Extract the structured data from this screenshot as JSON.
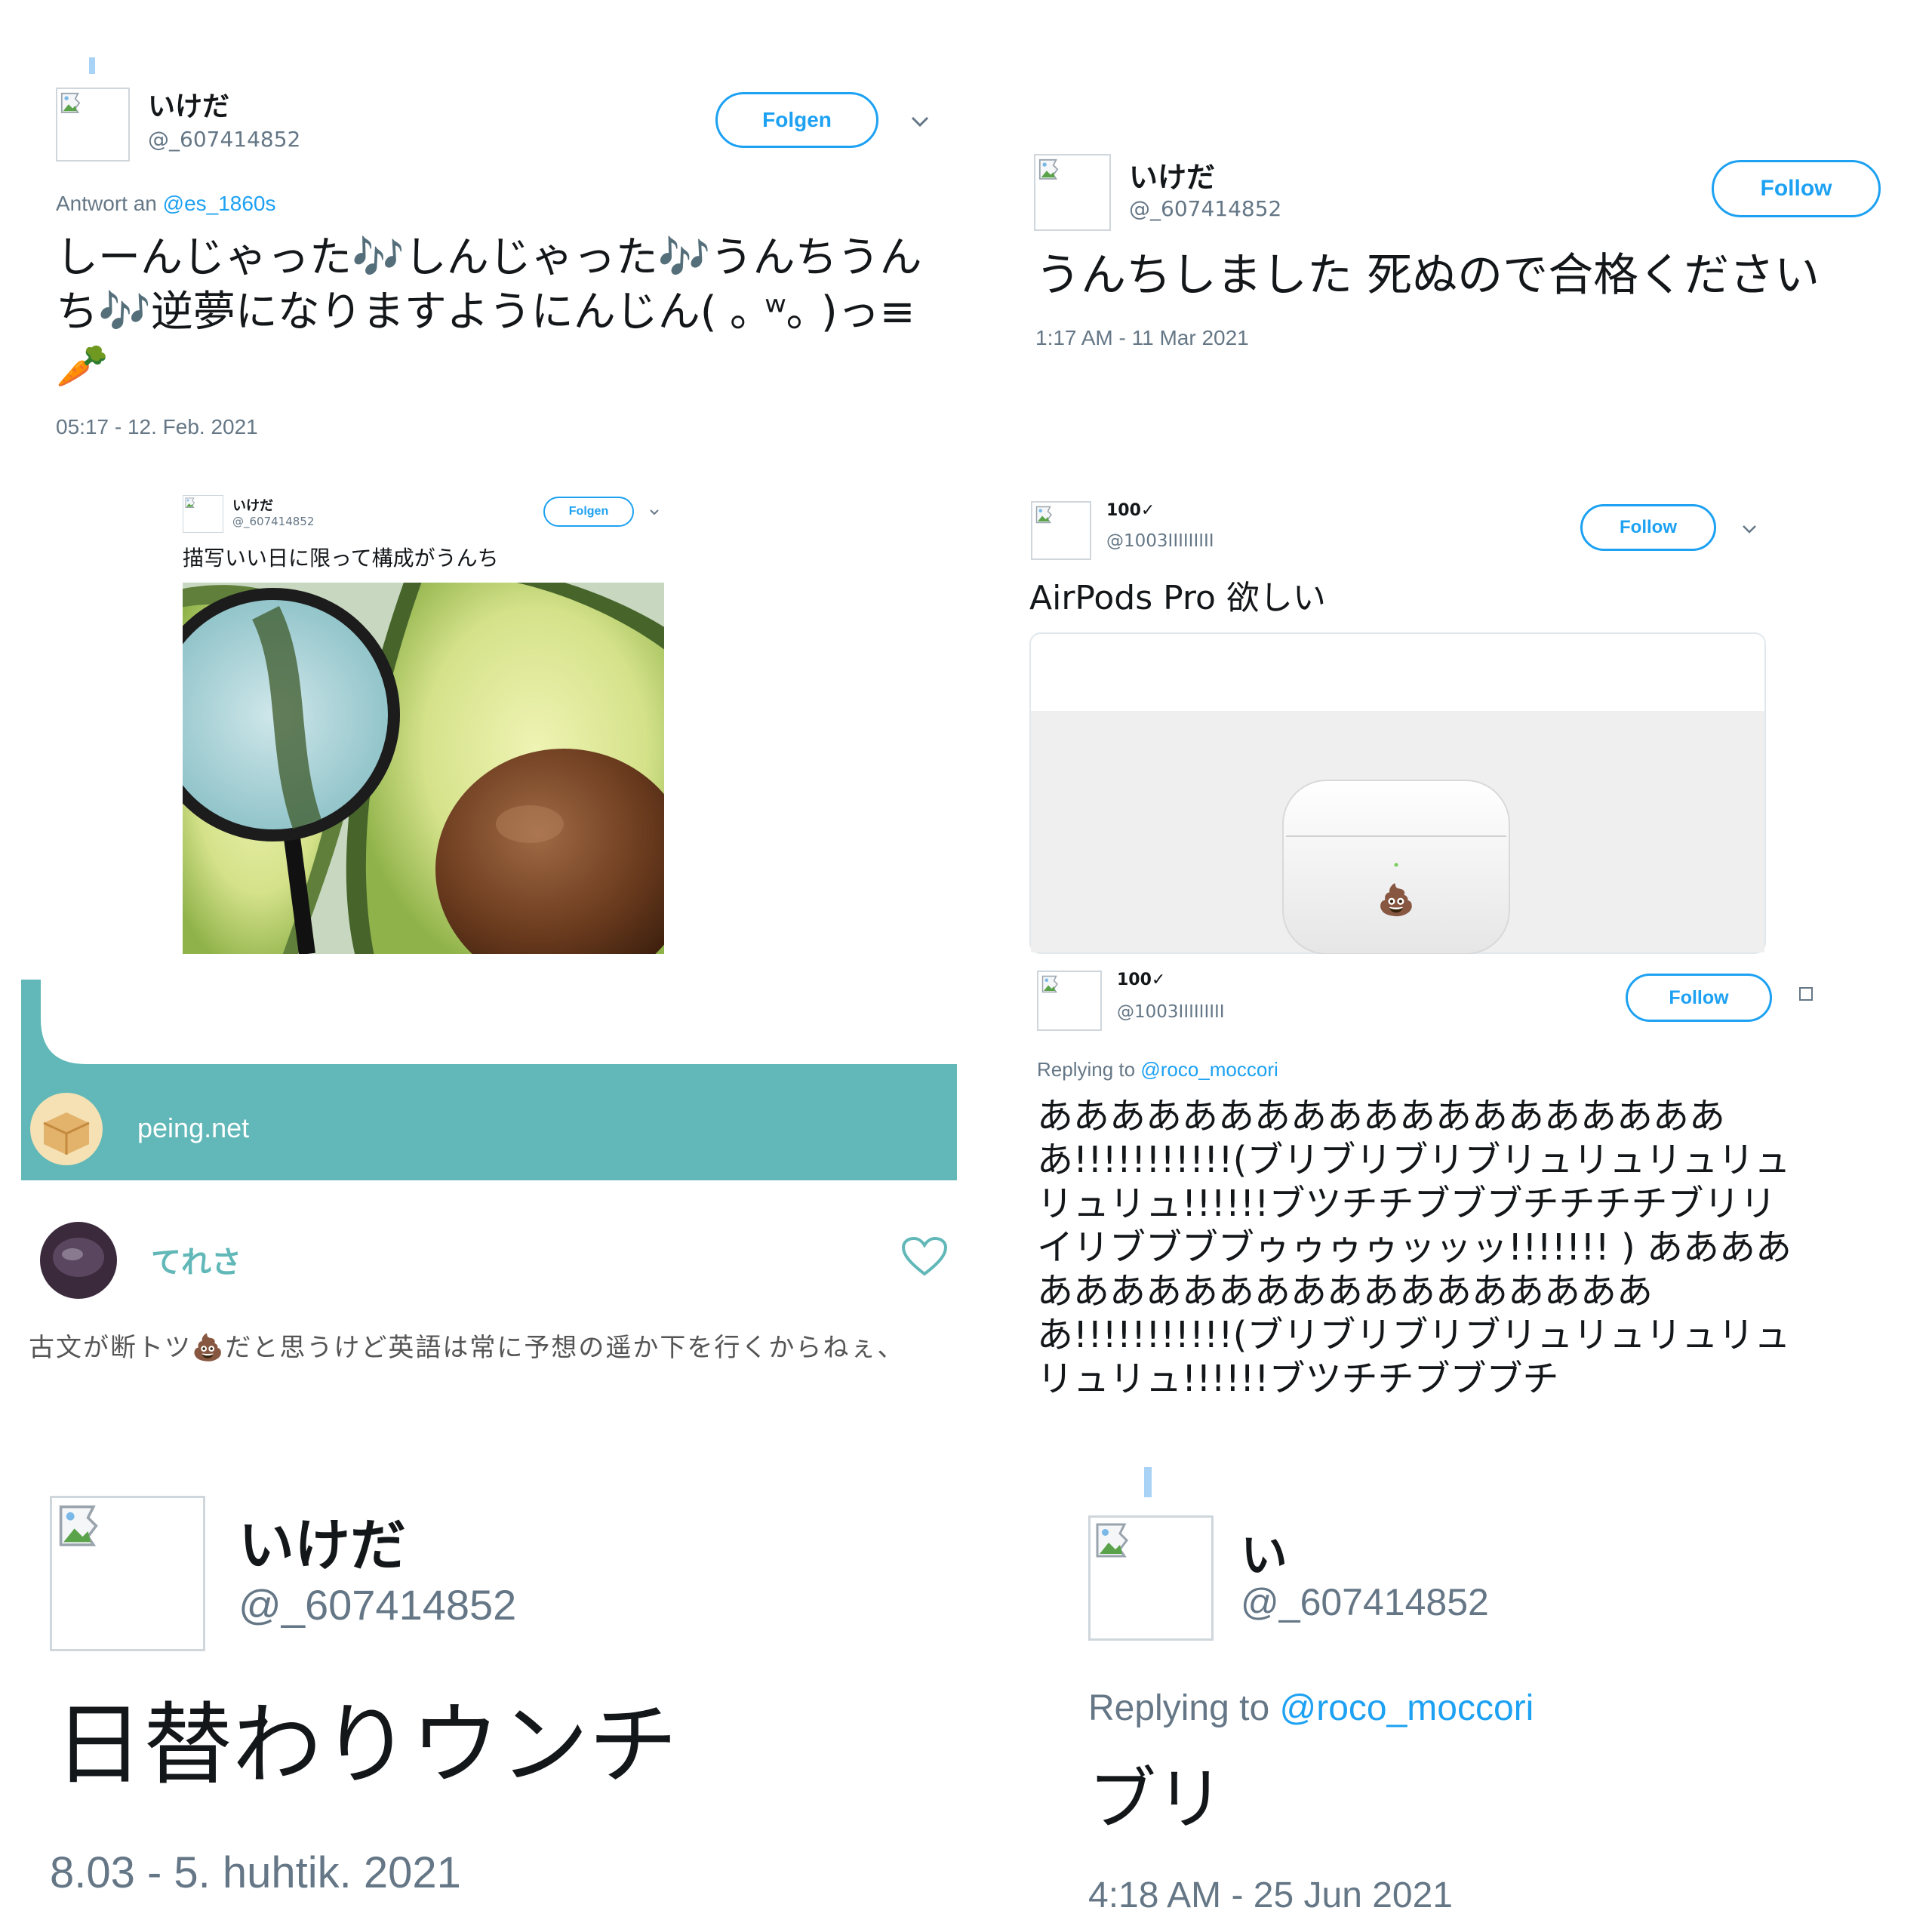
{
  "panel1": {
    "name": "いけだ",
    "handle": "@_607414852",
    "follow_label": "Folgen",
    "reply_prefix": "Antwort an",
    "reply_to": "@es_1860s",
    "text": "しーんじゃった🎶しんじゃった🎶うんちうんち🎶逆夢になりますようにんじん( ｡ ʷ｡ )っ≡🥕",
    "timestamp": "05:17 - 12. Feb. 2021"
  },
  "panel2": {
    "name": "いけだ",
    "handle": "@_607414852",
    "follow_label": "Follow",
    "text": "うんちしました 死ぬので合格ください",
    "timestamp": "1:17 AM - 11 Mar 2021"
  },
  "panel3": {
    "name": "いけだ",
    "handle": "@_607414852",
    "follow_label": "Folgen",
    "text": "描写いい日に限って構成がうんち"
  },
  "panel4": {
    "name": "100✓",
    "handle": "@1003IIIIIIIII",
    "follow_label": "Follow",
    "text": "AirPods Pro 欲しい"
  },
  "panel5": {
    "site": "peing.net",
    "user": "てれさ",
    "text": "古文が断トツ💩だと思うけど英語は常に予想の遥か下を行くからねぇ、"
  },
  "panel6": {
    "name": "100✓",
    "handle": "@1003IIIIIIIII",
    "follow_label": "Follow",
    "reply_prefix": "Replying to",
    "reply_to": "@roco_moccori",
    "text": "ああああああああああああああああああああ!!!!!!!!!!!(ブリブリブリブリュリュリュリュリュリュ!!!!!!ブツチチブブブチチチチブリリイリブブブブゥゥゥゥッッッ!!!!!!! ) ああああああああああああああああああああああ!!!!!!!!!!!(ブリブリブリブリュリュリュリュリュリュ!!!!!!ブツチチブブブチ"
  },
  "panel7": {
    "name": "いけだ",
    "handle": "@_607414852",
    "text": "日替わりウンチ",
    "timestamp": "8.03 - 5. huhtik. 2021"
  },
  "panel8": {
    "name": "い",
    "handle": "@_607414852",
    "reply_prefix": "Replying to",
    "reply_to": "@roco_moccori",
    "text": "ブリ",
    "timestamp": "4:18 AM - 25 Jun 2021"
  },
  "colors": {
    "accent": "#1da1f2",
    "peing_teal": "#62b8b8",
    "secondary_text": "#657786"
  }
}
